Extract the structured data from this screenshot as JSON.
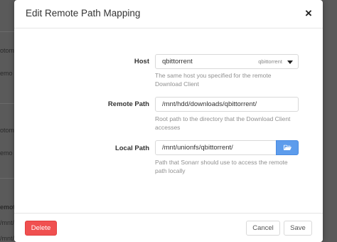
{
  "background": {
    "fragments": [
      "otom",
      "emo",
      "otom",
      "emo",
      "emot",
      "/mnt/",
      "/mnt/"
    ]
  },
  "modal": {
    "title": "Edit Remote Path Mapping",
    "close_glyph": "×"
  },
  "form": {
    "host": {
      "label": "Host",
      "value": "qbittorrent",
      "hint": "qbittorrent",
      "help": "The same host you specified for the remote Download Client"
    },
    "remote_path": {
      "label": "Remote Path",
      "value": "/mnt/hdd/downloads/qbittorrent/",
      "help": "Root path to the directory that the Download Client accesses"
    },
    "local_path": {
      "label": "Local Path",
      "value": "/mnt/unionfs/qbittorrent/",
      "help": "Path that Sonarr should use to access the remote path locally",
      "browse_icon": "folder-open-icon"
    }
  },
  "footer": {
    "delete_label": "Delete",
    "cancel_label": "Cancel",
    "save_label": "Save"
  },
  "colors": {
    "delete": "#f05050",
    "browse": "#5d9cec"
  }
}
